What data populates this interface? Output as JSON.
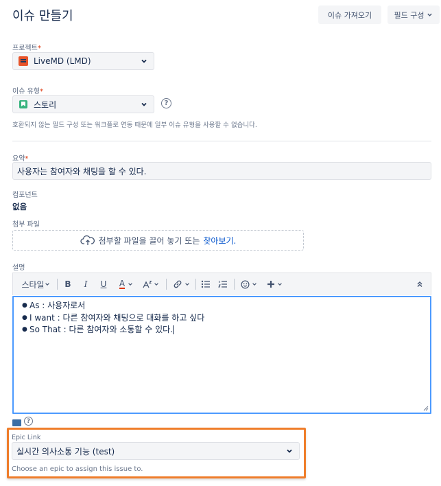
{
  "header": {
    "title": "이슈 만들기",
    "import_label": "이슈 가져오기",
    "config_label": "필드 구성"
  },
  "project": {
    "label": "프로젝트",
    "required": "*",
    "value": "LiveMD (LMD)"
  },
  "issue_type": {
    "label": "이슈 유형",
    "required": "*",
    "value": "스토리",
    "note": "호환되지 않는 필드 구성 또는 워크플로 연동 때문에 일부 이슈 유형을 사용할 수 없습니다."
  },
  "summary": {
    "label": "요약",
    "required": "*",
    "value": "사용자는 참여자와 채팅을 할 수 있다."
  },
  "components": {
    "label": "컴포넌트",
    "value": "없음"
  },
  "attachment": {
    "label": "첨부 파일",
    "drop_text": "첨부할 파일을 끌어 놓기 또는",
    "browse_link": "찾아보기."
  },
  "description": {
    "label": "설명",
    "toolbar": {
      "style_label": "스타일",
      "bold": "B",
      "italic": "I",
      "underline": "U",
      "color": "A"
    },
    "bullets": [
      "As : 사용자로서",
      "I want : 다른 참여자와 채팅으로 대화를 하고 싶다",
      "So That : 다른 참여자와 소통할 수 있다."
    ]
  },
  "epic_link": {
    "label": "Epic Link",
    "value": "실시간 의사소통 기능 (test)",
    "help": "Choose an epic to assign this issue to.",
    "highlight_color": "#ef7d2a"
  },
  "colors": {
    "accent": "#0052cc",
    "required": "#de350b",
    "focus": "#4c9aff"
  }
}
